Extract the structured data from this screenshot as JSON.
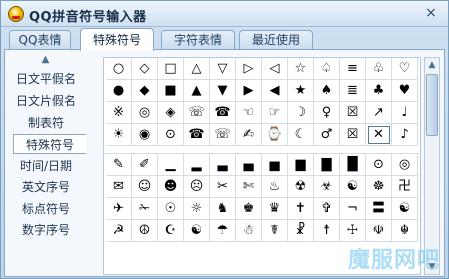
{
  "window": {
    "title": "QQ拼音符号输入器",
    "close_glyph": "×"
  },
  "tabs": [
    {
      "label": "QQ表情"
    },
    {
      "label": "特殊符号"
    },
    {
      "label": "字符表情"
    },
    {
      "label": "最近使用"
    }
  ],
  "active_tab": "特殊符号",
  "sidebar": {
    "scroll_up_glyph": "▲",
    "items": [
      {
        "label": "日文平假名"
      },
      {
        "label": "日文片假名"
      },
      {
        "label": "制表符"
      },
      {
        "label": "特殊符号"
      },
      {
        "label": "时间/日期"
      },
      {
        "label": "英文序号"
      },
      {
        "label": "标点符号"
      },
      {
        "label": "数字序号"
      }
    ],
    "active": "特殊符号"
  },
  "symbols": {
    "block1": [
      [
        "○",
        "◇",
        "□",
        "△",
        "▽",
        "▷",
        "◁",
        "☆",
        "♤",
        "≡",
        "♧",
        "♡"
      ],
      [
        "●",
        "◆",
        "■",
        "▲",
        "▼",
        "▶",
        "◀",
        "★",
        "♠",
        "≣",
        "♣",
        "♥"
      ],
      [
        "※",
        "◎",
        "◈",
        "☏",
        "☎",
        "☜",
        "☞",
        "☽",
        "♀",
        "☒",
        "↗",
        "♩"
      ],
      [
        "☀",
        "◉",
        "⊙",
        "☎",
        "☏",
        "✍",
        "⌚",
        "☾",
        "♂",
        "☒",
        "✕",
        "♪"
      ]
    ],
    "block2": [
      [
        "✎",
        "✐",
        "▁",
        "▂",
        "▃",
        "▄",
        "▅",
        "▆",
        "▇",
        "█",
        "⊙",
        "◎"
      ],
      [
        "✉",
        "☺",
        "☻",
        "☹",
        "✂",
        "✄",
        "♨",
        "☢",
        "☣",
        "☯",
        "☸",
        "卍"
      ],
      [
        "✈",
        "✁",
        "☉",
        "☼",
        "♞",
        "♚",
        "♛",
        "✝",
        "✞",
        "¬",
        "〓",
        "☯"
      ],
      [
        "☭",
        "☮",
        "☪",
        "☯",
        "☂",
        "☃",
        "☤",
        "☧",
        "☨",
        "☩",
        "☫",
        "☬"
      ]
    ],
    "selected": "✕"
  },
  "scrollbar": {
    "up_glyph": "▲",
    "down_glyph": "▼"
  },
  "watermark": "魔服网吧"
}
